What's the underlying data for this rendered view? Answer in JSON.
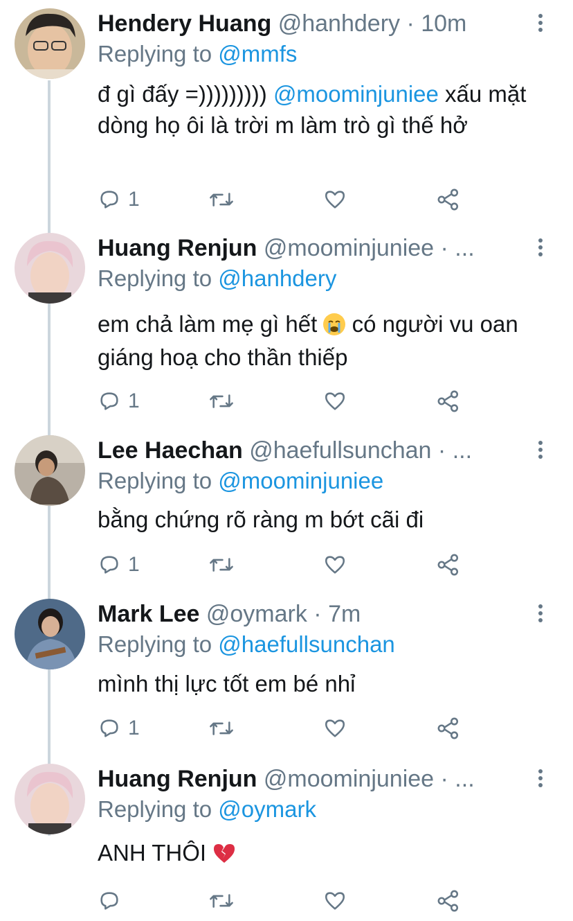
{
  "tweets": [
    {
      "name": "Hendery Huang",
      "handle": "@hanhdery",
      "dot": " · ",
      "time": "10m",
      "replying_prefix": "Replying to ",
      "replying_to": "@mmfs",
      "text_pre": "đ gì đấy =))))))))) ",
      "text_mention": "@moominjuniee",
      "text_post": " xấu mặt dòng họ ôi là trời m làm trò gì thế hở",
      "reply_count": "1",
      "avatar_icon": "profile-photo",
      "avatar_bg": "#c9b89a"
    },
    {
      "name": "Huang Renjun",
      "handle": "@moominjuniee",
      "dot": " · ",
      "time": "...",
      "replying_prefix": "Replying to ",
      "replying_to": "@hanhdery",
      "text_pre": "em chả làm mẹ gì hết ",
      "text_emoji": "loudly-crying-face",
      "text_post": " có người vu oan giáng hoạ cho thần thiếp",
      "reply_count": "1",
      "avatar_icon": "profile-photo",
      "avatar_bg": "#e9d7dc"
    },
    {
      "name": "Lee Haechan",
      "handle": "@haefullsunchan",
      "dot": " · ",
      "time": "...",
      "replying_prefix": "Replying to ",
      "replying_to": "@moominjuniee",
      "text": "bằng chứng rõ ràng m bớt cãi đi",
      "reply_count": "1",
      "avatar_icon": "profile-photo",
      "avatar_bg": "#b9b1a6"
    },
    {
      "name": "Mark Lee",
      "handle": "@oymark",
      "dot": " · ",
      "time": "7m",
      "replying_prefix": "Replying to ",
      "replying_to": "@haefullsunchan",
      "text": "mình thị lực tốt em bé nhỉ",
      "reply_count": "1",
      "avatar_icon": "profile-photo",
      "avatar_bg": "#4f6a88"
    },
    {
      "name": "Huang Renjun",
      "handle": "@moominjuniee",
      "dot": " · ",
      "time": "...",
      "replying_prefix": "Replying to ",
      "replying_to": "@oymark",
      "text_pre": "ANH THÔI ",
      "text_emoji": "broken-heart",
      "reply_count": "",
      "avatar_icon": "profile-photo",
      "avatar_bg": "#e9d7dc"
    }
  ],
  "icons": {
    "reply": "reply-icon",
    "retweet": "retweet-icon",
    "like": "heart-icon",
    "share": "share-icon",
    "more": "more-options-icon"
  },
  "colors": {
    "link": "#1b95e0",
    "secondary_text": "#657786",
    "primary_text": "#14171a",
    "thread_line": "#ccd6dd"
  }
}
